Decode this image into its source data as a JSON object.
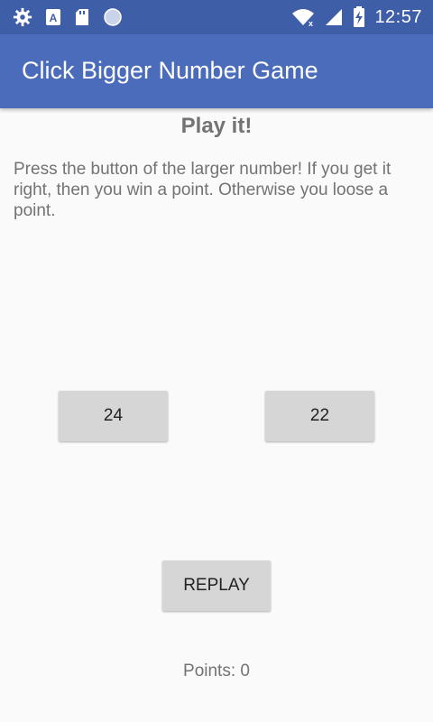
{
  "statusbar": {
    "time": "12:57",
    "icons": [
      "gear-icon",
      "font-a-icon",
      "sd-card-icon",
      "circle-icon",
      "wifi-icon",
      "cell-signal-icon",
      "battery-charging-icon"
    ]
  },
  "app": {
    "title": "Click Bigger Number Game"
  },
  "game": {
    "heading": "Play it!",
    "instructions": "Press the button of the larger number! If you get it right, then you win a point. Otherwise you loose a point.",
    "left_number": "24",
    "right_number": "22",
    "replay_label": "REPLAY",
    "points_text": "Points: 0"
  },
  "colors": {
    "statusbar": "#3e5fa8",
    "appbar": "#4a6cbb",
    "button": "#d6d6d6",
    "text": "#737373"
  }
}
